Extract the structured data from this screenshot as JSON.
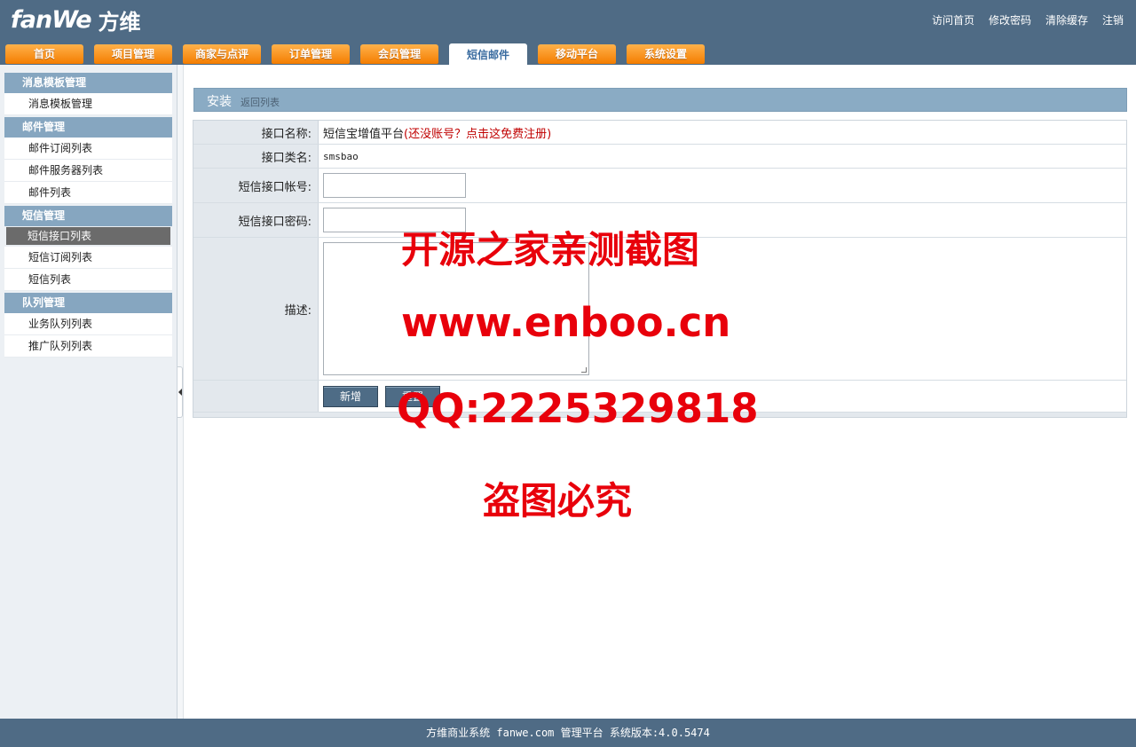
{
  "header": {
    "logo_en": "fanWe",
    "logo_cn": "方维",
    "links": [
      "访问首页",
      "修改密码",
      "清除缓存",
      "注销"
    ],
    "tabs": [
      "首页",
      "项目管理",
      "商家与点评",
      "订单管理",
      "会员管理",
      "短信邮件",
      "移动平台",
      "系统设置"
    ],
    "active_tab": "短信邮件"
  },
  "sidebar": {
    "groups": [
      {
        "title": "消息模板管理",
        "items": [
          "消息模板管理"
        ]
      },
      {
        "title": "邮件管理",
        "items": [
          "邮件订阅列表",
          "邮件服务器列表",
          "邮件列表"
        ]
      },
      {
        "title": "短信管理",
        "items": [
          "短信接口列表",
          "短信订阅列表",
          "短信列表"
        ]
      },
      {
        "title": "队列管理",
        "items": [
          "业务队列列表",
          "推广队列列表"
        ]
      }
    ],
    "active_item": "短信接口列表"
  },
  "panel": {
    "title": "安装",
    "back_link": "返回列表"
  },
  "form": {
    "name_label": "接口名称:",
    "name_value": "短信宝增值平台",
    "name_note": "(还没账号？点击这免费注册)",
    "class_label": "接口类名:",
    "class_value": "smsbao",
    "account_label": "短信接口帐号:",
    "account_value": "",
    "password_label": "短信接口密码:",
    "password_value": "",
    "desc_label": "描述:",
    "desc_value": "",
    "submit_label": "新增",
    "reset_label": "重置"
  },
  "watermark": {
    "line1": "开源之家亲测截图",
    "line2": "www.enboo.cn",
    "line3": "QQ:2225329818",
    "line4": "盗图必究"
  },
  "footer": {
    "text": "方维商业系统 fanwe.com 管理平台 系统版本:4.0.5474"
  }
}
